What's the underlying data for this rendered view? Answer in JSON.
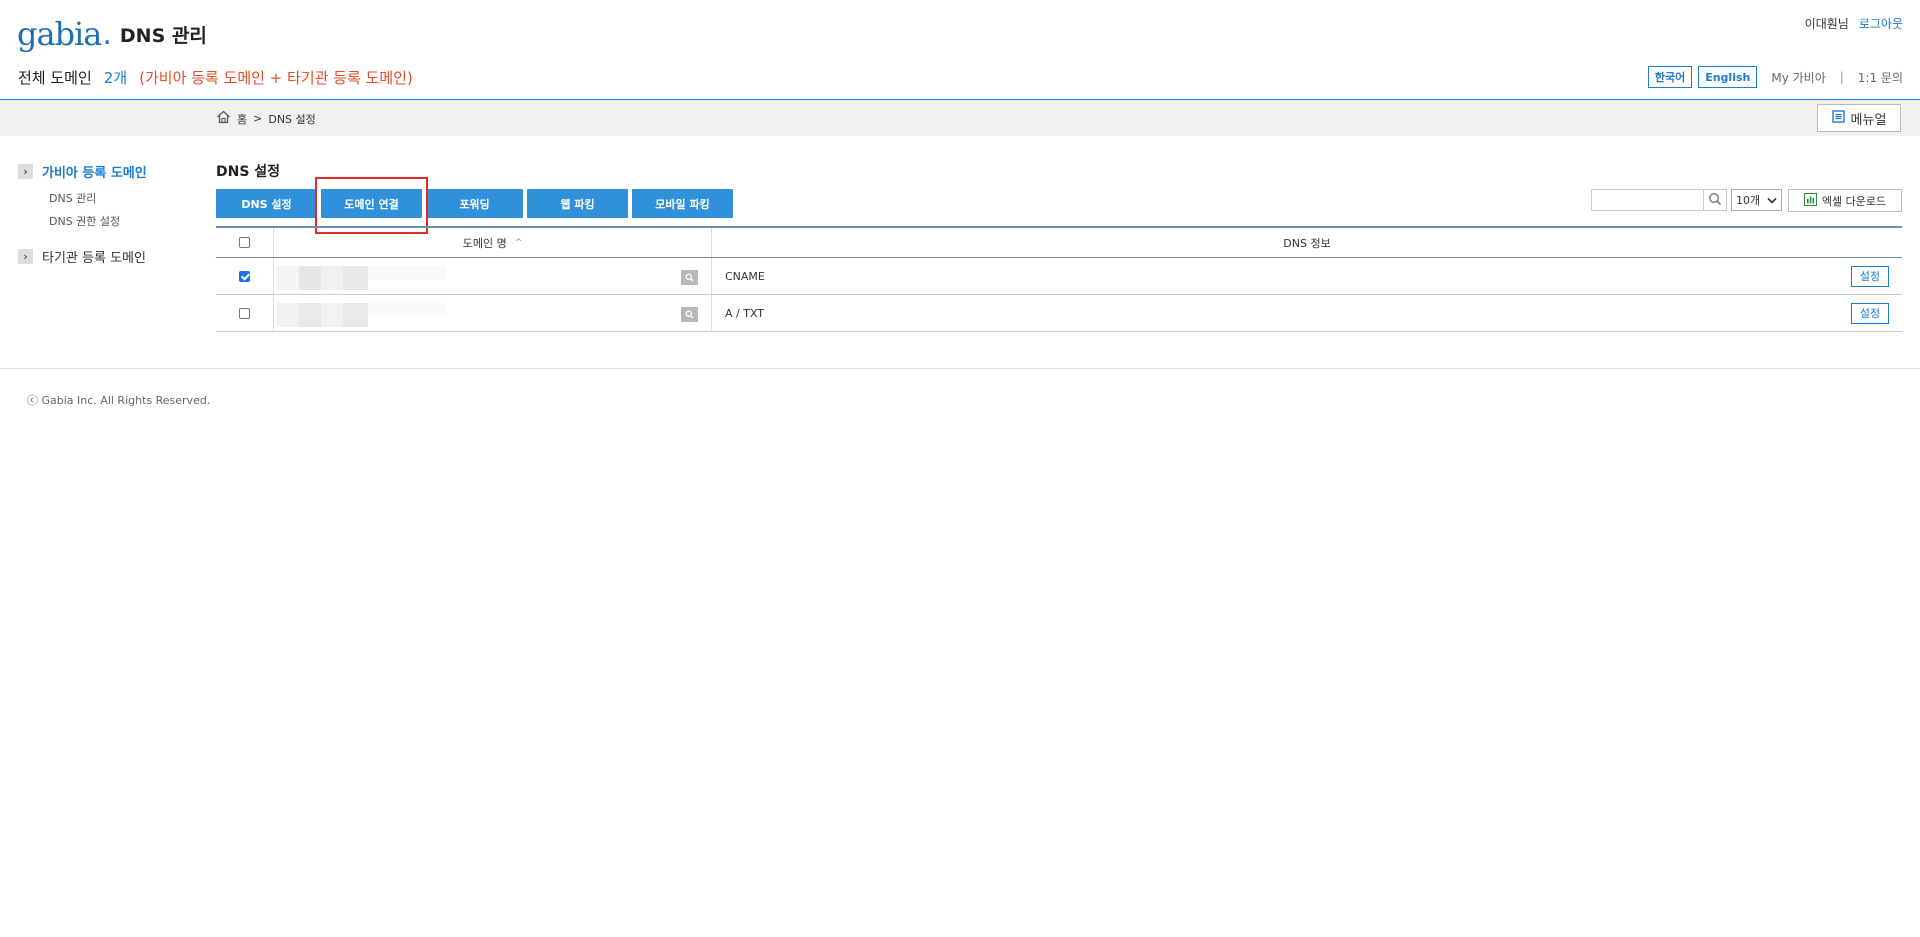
{
  "header": {
    "logo_text": "gabia",
    "app_title": "DNS 관리",
    "user_name": "이대훤님",
    "logout": "로그아웃",
    "summary_label": "전체 도메인",
    "summary_count": "2개",
    "summary_desc": "(가비아 등록 도메인 + 타기관 등록 도메인)",
    "lang_ko": "한국어",
    "lang_en": "English",
    "my_gabia": "My 가비아",
    "separator": "|",
    "inquiry": "1:1 문의"
  },
  "breadcrumb": {
    "home": "홈",
    "arrow": ">",
    "current": "DNS 설정"
  },
  "manual_button": "메뉴얼",
  "sidebar": {
    "groups": [
      {
        "label": "가비아 등록 도메인",
        "items": [
          "DNS 관리",
          "DNS 권한 설정"
        ]
      },
      {
        "label": "타기관 등록 도메인",
        "items": []
      }
    ]
  },
  "main": {
    "title": "DNS 설정",
    "tabs": [
      "DNS 설정",
      "도메인 연결",
      "포워딩",
      "웹 파킹",
      "모바일 파킹"
    ],
    "page_size": "10개",
    "excel_button": "엑셀 다운로드",
    "table": {
      "headers": [
        "도메인 명",
        "DNS 정보"
      ],
      "sort_icon": "^",
      "rows": [
        {
          "checked": true,
          "dns_info": "CNAME",
          "action": "설정"
        },
        {
          "checked": false,
          "dns_info": "A / TXT",
          "action": "설정"
        }
      ]
    }
  },
  "footer": {
    "copyright": "ⓒ Gabia Inc. All Rights Reserved."
  },
  "colors": {
    "accent": "#1d7ccf",
    "button": "#3091da",
    "highlight": "#e12a2a",
    "summary_desc": "#e2502a"
  }
}
